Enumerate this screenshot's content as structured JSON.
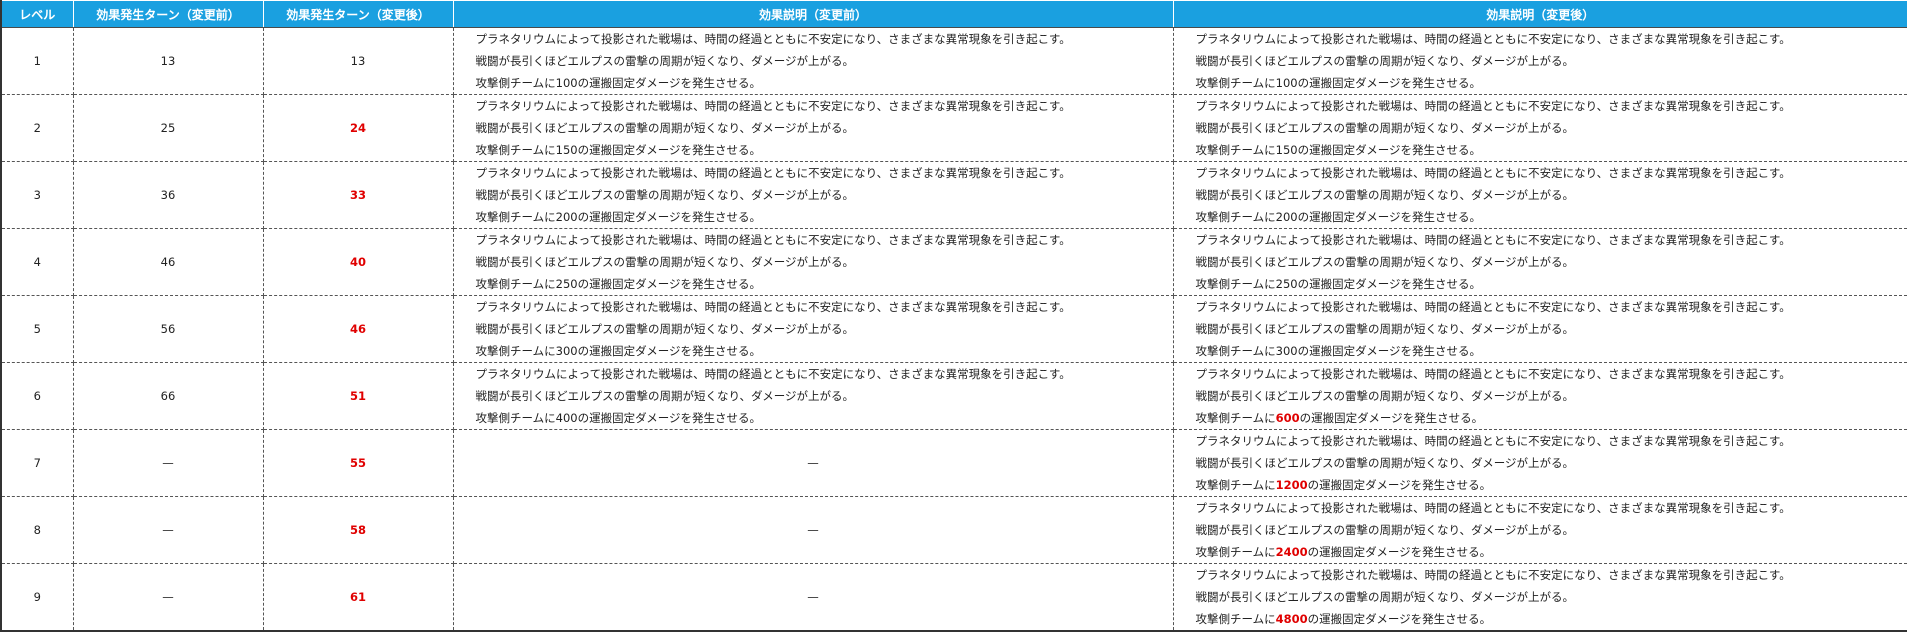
{
  "headers": {
    "level": "レベル",
    "turn_before": "効果発生ターン（変更前）",
    "turn_after": "効果発生ターン（変更後）",
    "desc_before": "効果説明（変更前）",
    "desc_after": "効果説明（変更後）"
  },
  "text": {
    "line1": "プラネタリウムによって投影された戦場は、時間の経過とともに不安定になり、さまざまな異常現象を引き起こす。",
    "line2": "戦闘が長引くほどエルプスの雷撃の周期が短くなり、ダメージが上がる。",
    "line3_prefix": "攻撃側チームに",
    "line3_suffix": "の運搬固定ダメージを発生させる。"
  },
  "rows": [
    {
      "level": "1",
      "turn_before": "13",
      "turn_after": "13",
      "dmg_before": "100",
      "dmg_after": "100",
      "after_changed": false
    },
    {
      "level": "2",
      "turn_before": "25",
      "turn_after": "24",
      "dmg_before": "150",
      "dmg_after": "150",
      "after_changed": false
    },
    {
      "level": "3",
      "turn_before": "36",
      "turn_after": "33",
      "dmg_before": "200",
      "dmg_after": "200",
      "after_changed": false
    },
    {
      "level": "4",
      "turn_before": "46",
      "turn_after": "40",
      "dmg_before": "250",
      "dmg_after": "250",
      "after_changed": false
    },
    {
      "level": "5",
      "turn_before": "56",
      "turn_after": "46",
      "dmg_before": "300",
      "dmg_after": "300",
      "after_changed": false
    },
    {
      "level": "6",
      "turn_before": "66",
      "turn_after": "51",
      "dmg_before": "400",
      "dmg_after": "600",
      "after_changed": true
    },
    {
      "level": "7",
      "turn_before": "—",
      "turn_after": "55",
      "dmg_before": null,
      "dmg_after": "1200",
      "after_changed": true
    },
    {
      "level": "8",
      "turn_before": "—",
      "turn_after": "58",
      "dmg_before": null,
      "dmg_after": "2400",
      "after_changed": true
    },
    {
      "level": "9",
      "turn_before": "—",
      "turn_after": "61",
      "dmg_before": null,
      "dmg_after": "4800",
      "after_changed": true
    }
  ],
  "empty_dash": "—",
  "colors": {
    "header_bg": "#1aa0e0",
    "highlight": "#e00000"
  }
}
